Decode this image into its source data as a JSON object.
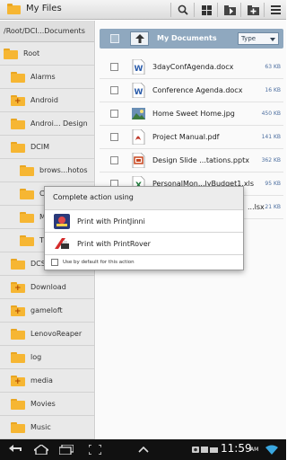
{
  "app": {
    "title": "My Files"
  },
  "toolbar": {
    "buttons": [
      "search-icon",
      "grid-view-icon",
      "move-folder-icon",
      "new-folder-icon",
      "menu-icon"
    ]
  },
  "left_pane": {
    "path": "/Root/DCI...Documents",
    "items": [
      {
        "label": "Root",
        "level": 0,
        "plus": false
      },
      {
        "label": "Alarms",
        "level": 1,
        "plus": false
      },
      {
        "label": "Android",
        "level": 1,
        "plus": true
      },
      {
        "label": "Androi... Design",
        "level": 1,
        "plus": false
      },
      {
        "label": "DCIM",
        "level": 1,
        "plus": false
      },
      {
        "label": "brows...hotos",
        "level": 2,
        "plus": false
      },
      {
        "label": "C",
        "level": 2,
        "plus": false
      },
      {
        "label": "M",
        "level": 2,
        "plus": false
      },
      {
        "label": "T",
        "level": 2,
        "plus": false
      },
      {
        "label": "DCS",
        "level": 1,
        "plus": false
      },
      {
        "label": "Download",
        "level": 1,
        "plus": true
      },
      {
        "label": "gameloft",
        "level": 1,
        "plus": true
      },
      {
        "label": "LenovoReaper",
        "level": 1,
        "plus": false
      },
      {
        "label": "log",
        "level": 1,
        "plus": false
      },
      {
        "label": "media",
        "level": 1,
        "plus": true
      },
      {
        "label": "Movies",
        "level": 1,
        "plus": false
      },
      {
        "label": "Music",
        "level": 1,
        "plus": false
      }
    ]
  },
  "list_header": {
    "title": "My Documents",
    "sort_label": "Type"
  },
  "files": [
    {
      "name": "3dayConfAgenda.docx",
      "size": "63 KB",
      "type": "word",
      "color": "#2b5caa"
    },
    {
      "name": "Conference Agenda.docx",
      "size": "16 KB",
      "type": "word",
      "color": "#2b5caa"
    },
    {
      "name": "Home Sweet Home.jpg",
      "size": "450 KB",
      "type": "image",
      "color": "#6a8fb5"
    },
    {
      "name": "Project Manual.pdf",
      "size": "141 KB",
      "type": "pdf",
      "color": "#c0392b"
    },
    {
      "name": "Design Slide ...tations.pptx",
      "size": "362 KB",
      "type": "ppt",
      "color": "#c8461f"
    },
    {
      "name": "PersonalMon...lyBudget1.xls",
      "size": "95 KB",
      "type": "excel",
      "color": "#1e7a3a"
    },
    {
      "name": "...lsx",
      "size": "21 KB",
      "type": "excel",
      "color": "#1e7a3a"
    }
  ],
  "dialog": {
    "title": "Complete action using",
    "options": [
      {
        "label": "Print with PrintJinni",
        "icon": "printjinni-icon"
      },
      {
        "label": "Print with PrintRover",
        "icon": "printrover-icon"
      }
    ],
    "default_label": "Use by default for this action"
  },
  "system_bar": {
    "time": "11:59",
    "ampm": "AM"
  }
}
